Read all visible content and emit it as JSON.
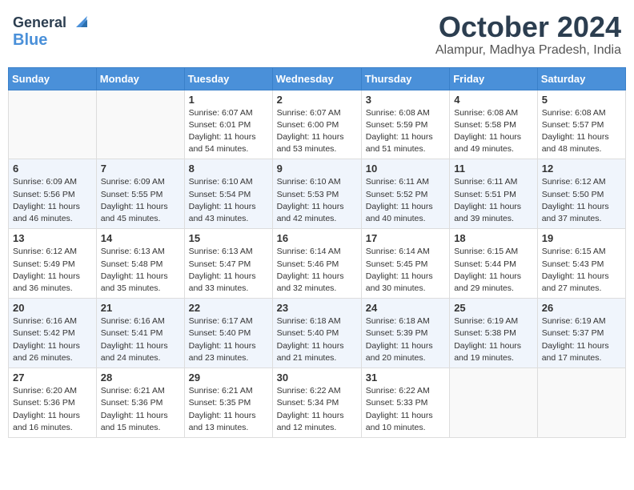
{
  "header": {
    "logo_line1": "General",
    "logo_line2": "Blue",
    "month_title": "October 2024",
    "location": "Alampur, Madhya Pradesh, India"
  },
  "weekdays": [
    "Sunday",
    "Monday",
    "Tuesday",
    "Wednesday",
    "Thursday",
    "Friday",
    "Saturday"
  ],
  "weeks": [
    [
      {
        "day": "",
        "sunrise": "",
        "sunset": "",
        "daylight": ""
      },
      {
        "day": "",
        "sunrise": "",
        "sunset": "",
        "daylight": ""
      },
      {
        "day": "1",
        "sunrise": "Sunrise: 6:07 AM",
        "sunset": "Sunset: 6:01 PM",
        "daylight": "Daylight: 11 hours and 54 minutes."
      },
      {
        "day": "2",
        "sunrise": "Sunrise: 6:07 AM",
        "sunset": "Sunset: 6:00 PM",
        "daylight": "Daylight: 11 hours and 53 minutes."
      },
      {
        "day": "3",
        "sunrise": "Sunrise: 6:08 AM",
        "sunset": "Sunset: 5:59 PM",
        "daylight": "Daylight: 11 hours and 51 minutes."
      },
      {
        "day": "4",
        "sunrise": "Sunrise: 6:08 AM",
        "sunset": "Sunset: 5:58 PM",
        "daylight": "Daylight: 11 hours and 49 minutes."
      },
      {
        "day": "5",
        "sunrise": "Sunrise: 6:08 AM",
        "sunset": "Sunset: 5:57 PM",
        "daylight": "Daylight: 11 hours and 48 minutes."
      }
    ],
    [
      {
        "day": "6",
        "sunrise": "Sunrise: 6:09 AM",
        "sunset": "Sunset: 5:56 PM",
        "daylight": "Daylight: 11 hours and 46 minutes."
      },
      {
        "day": "7",
        "sunrise": "Sunrise: 6:09 AM",
        "sunset": "Sunset: 5:55 PM",
        "daylight": "Daylight: 11 hours and 45 minutes."
      },
      {
        "day": "8",
        "sunrise": "Sunrise: 6:10 AM",
        "sunset": "Sunset: 5:54 PM",
        "daylight": "Daylight: 11 hours and 43 minutes."
      },
      {
        "day": "9",
        "sunrise": "Sunrise: 6:10 AM",
        "sunset": "Sunset: 5:53 PM",
        "daylight": "Daylight: 11 hours and 42 minutes."
      },
      {
        "day": "10",
        "sunrise": "Sunrise: 6:11 AM",
        "sunset": "Sunset: 5:52 PM",
        "daylight": "Daylight: 11 hours and 40 minutes."
      },
      {
        "day": "11",
        "sunrise": "Sunrise: 6:11 AM",
        "sunset": "Sunset: 5:51 PM",
        "daylight": "Daylight: 11 hours and 39 minutes."
      },
      {
        "day": "12",
        "sunrise": "Sunrise: 6:12 AM",
        "sunset": "Sunset: 5:50 PM",
        "daylight": "Daylight: 11 hours and 37 minutes."
      }
    ],
    [
      {
        "day": "13",
        "sunrise": "Sunrise: 6:12 AM",
        "sunset": "Sunset: 5:49 PM",
        "daylight": "Daylight: 11 hours and 36 minutes."
      },
      {
        "day": "14",
        "sunrise": "Sunrise: 6:13 AM",
        "sunset": "Sunset: 5:48 PM",
        "daylight": "Daylight: 11 hours and 35 minutes."
      },
      {
        "day": "15",
        "sunrise": "Sunrise: 6:13 AM",
        "sunset": "Sunset: 5:47 PM",
        "daylight": "Daylight: 11 hours and 33 minutes."
      },
      {
        "day": "16",
        "sunrise": "Sunrise: 6:14 AM",
        "sunset": "Sunset: 5:46 PM",
        "daylight": "Daylight: 11 hours and 32 minutes."
      },
      {
        "day": "17",
        "sunrise": "Sunrise: 6:14 AM",
        "sunset": "Sunset: 5:45 PM",
        "daylight": "Daylight: 11 hours and 30 minutes."
      },
      {
        "day": "18",
        "sunrise": "Sunrise: 6:15 AM",
        "sunset": "Sunset: 5:44 PM",
        "daylight": "Daylight: 11 hours and 29 minutes."
      },
      {
        "day": "19",
        "sunrise": "Sunrise: 6:15 AM",
        "sunset": "Sunset: 5:43 PM",
        "daylight": "Daylight: 11 hours and 27 minutes."
      }
    ],
    [
      {
        "day": "20",
        "sunrise": "Sunrise: 6:16 AM",
        "sunset": "Sunset: 5:42 PM",
        "daylight": "Daylight: 11 hours and 26 minutes."
      },
      {
        "day": "21",
        "sunrise": "Sunrise: 6:16 AM",
        "sunset": "Sunset: 5:41 PM",
        "daylight": "Daylight: 11 hours and 24 minutes."
      },
      {
        "day": "22",
        "sunrise": "Sunrise: 6:17 AM",
        "sunset": "Sunset: 5:40 PM",
        "daylight": "Daylight: 11 hours and 23 minutes."
      },
      {
        "day": "23",
        "sunrise": "Sunrise: 6:18 AM",
        "sunset": "Sunset: 5:40 PM",
        "daylight": "Daylight: 11 hours and 21 minutes."
      },
      {
        "day": "24",
        "sunrise": "Sunrise: 6:18 AM",
        "sunset": "Sunset: 5:39 PM",
        "daylight": "Daylight: 11 hours and 20 minutes."
      },
      {
        "day": "25",
        "sunrise": "Sunrise: 6:19 AM",
        "sunset": "Sunset: 5:38 PM",
        "daylight": "Daylight: 11 hours and 19 minutes."
      },
      {
        "day": "26",
        "sunrise": "Sunrise: 6:19 AM",
        "sunset": "Sunset: 5:37 PM",
        "daylight": "Daylight: 11 hours and 17 minutes."
      }
    ],
    [
      {
        "day": "27",
        "sunrise": "Sunrise: 6:20 AM",
        "sunset": "Sunset: 5:36 PM",
        "daylight": "Daylight: 11 hours and 16 minutes."
      },
      {
        "day": "28",
        "sunrise": "Sunrise: 6:21 AM",
        "sunset": "Sunset: 5:36 PM",
        "daylight": "Daylight: 11 hours and 15 minutes."
      },
      {
        "day": "29",
        "sunrise": "Sunrise: 6:21 AM",
        "sunset": "Sunset: 5:35 PM",
        "daylight": "Daylight: 11 hours and 13 minutes."
      },
      {
        "day": "30",
        "sunrise": "Sunrise: 6:22 AM",
        "sunset": "Sunset: 5:34 PM",
        "daylight": "Daylight: 11 hours and 12 minutes."
      },
      {
        "day": "31",
        "sunrise": "Sunrise: 6:22 AM",
        "sunset": "Sunset: 5:33 PM",
        "daylight": "Daylight: 11 hours and 10 minutes."
      },
      {
        "day": "",
        "sunrise": "",
        "sunset": "",
        "daylight": ""
      },
      {
        "day": "",
        "sunrise": "",
        "sunset": "",
        "daylight": ""
      }
    ]
  ]
}
